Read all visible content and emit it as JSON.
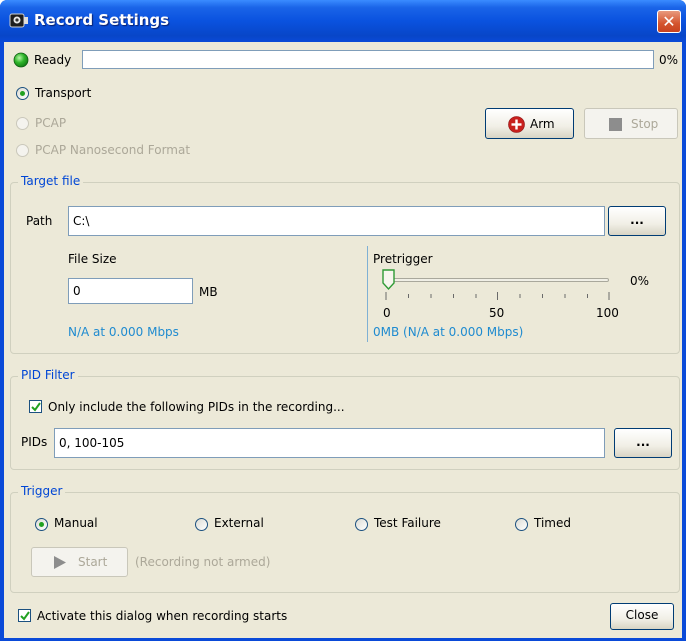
{
  "window": {
    "title": "Record Settings",
    "close_glyph": "✕"
  },
  "status": {
    "label": "Ready",
    "progress_percent_label": "0%",
    "progress_fraction": 0
  },
  "format": {
    "options": [
      {
        "label": "Transport",
        "checked": true,
        "enabled": true
      },
      {
        "label": "PCAP",
        "checked": false,
        "enabled": false
      },
      {
        "label": "PCAP Nanosecond Format",
        "checked": false,
        "enabled": false
      }
    ]
  },
  "actions": {
    "arm_label": "Arm",
    "stop_label": "Stop"
  },
  "target_file": {
    "legend": "Target file",
    "path_label": "Path",
    "path_value": "C:\\",
    "browse_label": "...",
    "file_size_label": "File Size",
    "file_size_value": "0",
    "file_size_unit": "MB",
    "file_size_info": "N/A at 0.000 Mbps",
    "pretrigger_label": "Pretrigger",
    "pretrigger_value_label": "0%",
    "pretrigger_fraction": 0,
    "pretrigger_ticks": [
      "0",
      "50",
      "100"
    ],
    "pretrigger_info": "0MB (N/A at 0.000 Mbps)"
  },
  "pid_filter": {
    "legend": "PID Filter",
    "only_include_label": "Only include the following PIDs in the recording...",
    "only_include_checked": true,
    "pids_label": "PIDs",
    "pids_value": "0, 100-105",
    "browse_label": "..."
  },
  "trigger": {
    "legend": "Trigger",
    "options": [
      {
        "label": "Manual",
        "checked": true
      },
      {
        "label": "External",
        "checked": false
      },
      {
        "label": "Test Failure",
        "checked": false
      },
      {
        "label": "Timed",
        "checked": false
      }
    ],
    "start_label": "Start",
    "start_status": "(Recording not armed)"
  },
  "footer": {
    "activate_label": "Activate this dialog when recording starts",
    "activate_checked": true,
    "close_label": "Close"
  }
}
